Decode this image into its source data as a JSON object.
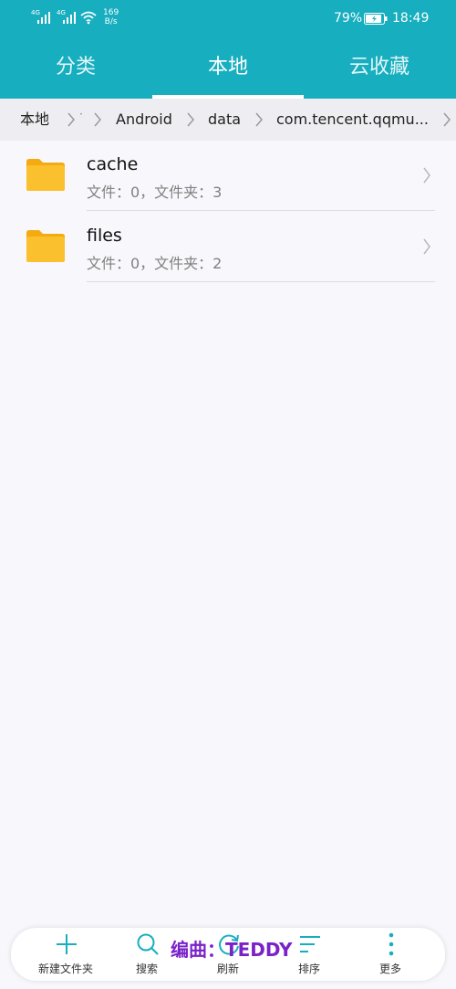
{
  "status_bar": {
    "network_labels": [
      "4G",
      "4G"
    ],
    "speed_value": "169",
    "speed_unit": "B/s",
    "battery": "79%",
    "time": "18:49"
  },
  "tabs": [
    {
      "label": "分类",
      "active": false
    },
    {
      "label": "本地",
      "active": true
    },
    {
      "label": "云收藏",
      "active": false
    }
  ],
  "breadcrumb": {
    "items": [
      "本地",
      "Android",
      "data",
      "com.tencent.qqmu..."
    ]
  },
  "files": [
    {
      "name": "cache",
      "meta": "文件：0，文件夹：3"
    },
    {
      "name": "files",
      "meta": "文件：0，文件夹：2"
    }
  ],
  "toolbar": {
    "items": [
      {
        "label": "新建文件夹",
        "icon": "plus-icon"
      },
      {
        "label": "搜索",
        "icon": "search-icon"
      },
      {
        "label": "刷新",
        "icon": "refresh-icon"
      },
      {
        "label": "排序",
        "icon": "sort-icon"
      },
      {
        "label": "更多",
        "icon": "more-icon"
      }
    ]
  },
  "watermark": "编曲：TEDDY",
  "colors": {
    "accent": "#17aebf",
    "folder": "#fbbf25",
    "watermark": "#7a22c8"
  }
}
